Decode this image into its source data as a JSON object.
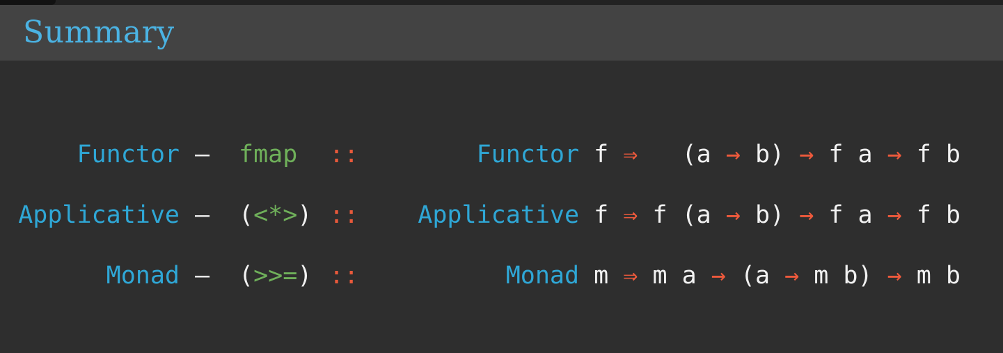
{
  "slide": {
    "title": "Summary"
  },
  "rows": [
    {
      "class_name": "Functor",
      "dash": "—",
      "op_open": "",
      "op_inner": "fmap",
      "op_close": "",
      "colons": "::",
      "sig": {
        "cls": "Functor",
        "var": " f ",
        "fat_arrow": "⇒",
        "p1": "   (a ",
        "a1": "→",
        "p2": " b) ",
        "a2": "→",
        "p3": " f a ",
        "a3": "→",
        "p4": " f b"
      }
    },
    {
      "class_name": "Applicative",
      "dash": "—",
      "op_open": "(",
      "op_inner": "<*>",
      "op_close": ")",
      "colons": "::",
      "sig": {
        "cls": "Applicative",
        "var": " f ",
        "fat_arrow": "⇒",
        "p1": " f (a ",
        "a1": "→",
        "p2": " b) ",
        "a2": "→",
        "p3": " f a ",
        "a3": "→",
        "p4": " f b"
      }
    },
    {
      "class_name": "Monad",
      "dash": "—",
      "op_open": "(",
      "op_inner": ">>=",
      "op_close": ")",
      "colons": "::",
      "sig": {
        "cls": "Monad",
        "var": " m ",
        "fat_arrow": "⇒",
        "p1": " m a ",
        "a1": "→",
        "p2": " (a ",
        "a2": "→",
        "p3": " m b) ",
        "a3": "→",
        "p4": " m b"
      }
    }
  ]
}
